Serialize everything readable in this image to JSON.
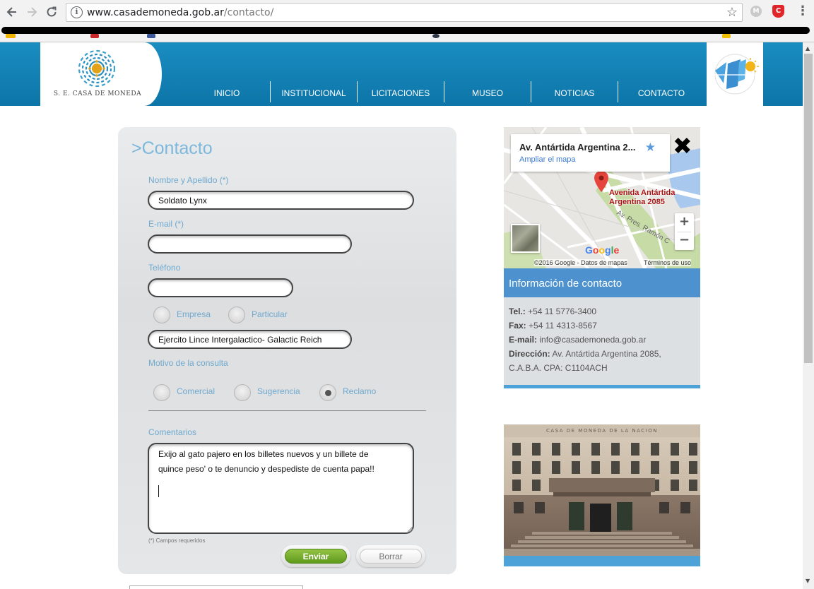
{
  "browser": {
    "url_domain": "www.casademoneda.gob.ar",
    "url_path": "/contacto/",
    "back_icon": "arrow-left-icon",
    "forward_icon": "arrow-right-icon",
    "reload_icon": "reload-icon",
    "ext1_label": "M",
    "ext2_label": "C"
  },
  "site": {
    "logo_text": "S. E. CASA DE MONEDA",
    "nav": [
      "INICIO",
      "INSTITUCIONAL",
      "LICITACIONES",
      "MUSEO",
      "NOTICIAS",
      "CONTACTO"
    ]
  },
  "form": {
    "title": ">Contacto",
    "name_label": "Nombre y Apellido (*)",
    "name_value": "Soldato Lynx",
    "email_label": "E-mail (*)",
    "email_value": "",
    "phone_label": "Teléfono",
    "phone_value": "",
    "type_options": [
      "Empresa",
      "Particular"
    ],
    "company_value": "Ejercito Lince Intergalactico- Galactic Reich",
    "reason_label": "Motivo de la consulta",
    "reason_options": [
      "Comercial",
      "Sugerencia",
      "Reclamo"
    ],
    "reason_selected": "Reclamo",
    "comments_label": "Comentarios",
    "comments_line1": "Exijo al gato pajero en los billetes nuevos y un billete de",
    "comments_line2": "quince peso' o te denuncio y despediste de cuenta papa!!",
    "required_note": "(*) Campos requeridos",
    "submit_label": "Enviar",
    "reset_label": "Borrar"
  },
  "map": {
    "place_title": "Av. Antártida Argentina 2...",
    "enlarge_link": "Ampliar el mapa",
    "pin_label_1": "Avenida Antártida",
    "pin_label_2": "Argentina 2085",
    "street_label": "Av. Pres. Ramón C",
    "google": "Google",
    "footer_copyright": "©2016 Google - Datos de mapas",
    "footer_terms": "Términos de uso",
    "zoom_in": "+",
    "zoom_out": "−"
  },
  "contact_info": {
    "heading": "Información de contacto",
    "tel_label": "Tel.:",
    "tel_value": "+54 11 5776-3400",
    "fax_label": "Fax:",
    "fax_value": "+54 11 4313-8567",
    "email_label": "E-mail:",
    "email_value": "info@casademoneda.gob.ar",
    "address_label": "Dirección:",
    "address_value": "Av. Antártida Argentina 2085,",
    "address_line2": "C.A.B.A. CPA: C1104ACH"
  },
  "photo": {
    "facade_text": "CASA DE MONEDA DE LA NACION"
  }
}
